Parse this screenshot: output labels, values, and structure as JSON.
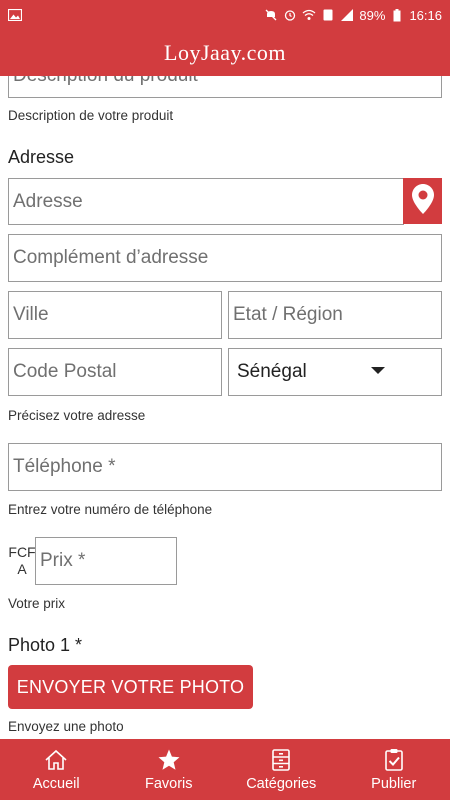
{
  "status_bar": {
    "battery": "89%",
    "time": "16:16"
  },
  "app": {
    "title": "LoyJaay.com"
  },
  "form": {
    "description_input_placeholder": "Description du produit",
    "description_help": "Description de votre  produit",
    "address_section_label": "Adresse",
    "address_placeholder": "Adresse",
    "address_complement_placeholder": "Complément d’adresse",
    "city_placeholder": "Ville",
    "region_placeholder": "Etat / Région",
    "postal_code_placeholder": "Code Postal",
    "country_selected": "Sénégal",
    "address_help": "Précisez votre adresse",
    "phone_placeholder": "Téléphone *",
    "phone_help": "Entrez votre numéro de téléphone",
    "currency_line1": "FCF",
    "currency_line2": "A",
    "price_placeholder": "Prix *",
    "price_help": "Votre prix",
    "photo_label": "Photo 1 *",
    "upload_button": "ENVOYER VOTRE PHOTO",
    "photo_help": "Envoyez une photo"
  },
  "bottom_nav": {
    "items": [
      {
        "label": "Accueil",
        "icon": "home-icon"
      },
      {
        "label": "Favoris",
        "icon": "star-icon"
      },
      {
        "label": "Catégories",
        "icon": "categories-icon"
      },
      {
        "label": "Publier",
        "icon": "publish-icon"
      }
    ]
  },
  "colors": {
    "brand": "#d23c3f",
    "border": "#9a9a9a"
  }
}
